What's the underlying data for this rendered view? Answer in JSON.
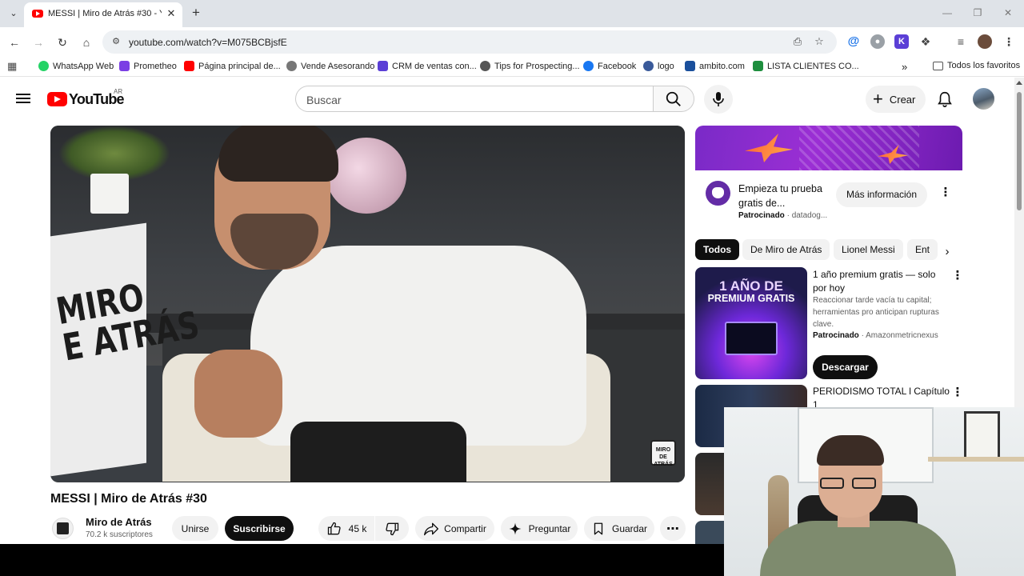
{
  "browser": {
    "tab_title": "MESSI | Miro de Atrás #30 - You",
    "url": "youtube.com/watch?v=M075BCBjsfE",
    "bookmarks": [
      {
        "label": "WhatsApp Web",
        "icon": "whatsapp-icon",
        "color": "#25d366"
      },
      {
        "label": "Prometheo",
        "icon": "prometheo-icon",
        "color": "#7b3fe4"
      },
      {
        "label": "Página principal de...",
        "icon": "youtube-icon",
        "color": "#ff0000"
      },
      {
        "label": "Vende Asesorando",
        "icon": "vende-icon",
        "color": "#555555"
      },
      {
        "label": "CRM de ventas con...",
        "icon": "crm-icon",
        "color": "#5b3fd6"
      },
      {
        "label": "Tips for Prospecting...",
        "icon": "gear-icon",
        "color": "#444444"
      },
      {
        "label": "Facebook",
        "icon": "facebook-icon",
        "color": "#1877f2"
      },
      {
        "label": "logo",
        "icon": "logo-icon",
        "color": "#3a5a9a"
      },
      {
        "label": "ambito.com",
        "icon": "ambito-icon",
        "color": "#1a4f9c"
      },
      {
        "label": "LISTA CLIENTES CO...",
        "icon": "sheets-icon",
        "color": "#1e8e3e"
      }
    ],
    "all_bookmarks_label": "Todos los favoritos"
  },
  "youtube": {
    "logo_text": "YouTube",
    "region": "AR",
    "search_placeholder": "Buscar",
    "create_label": "Crear",
    "video": {
      "title": "MESSI | Miro de Atrás #30",
      "channel_name": "Miro de Atrás",
      "subscribers": "70.2 k suscriptores",
      "join_label": "Unirse",
      "subscribe_label": "Suscribirse",
      "likes": "45 k",
      "share_label": "Compartir",
      "ask_label": "Preguntar",
      "save_label": "Guardar",
      "watermark_text": "MIRO DE ATRÁS",
      "cube_text": "MIRO\nE ATRÁS"
    },
    "ad_card": {
      "title": "Empieza tu prueba gratis de...",
      "sponsored_label": "Patrocinado",
      "advertiser": "datadog...",
      "cta_label": "Más información"
    },
    "chips": [
      "Todos",
      "De Miro de Atrás",
      "Lionel Messi",
      "Ent"
    ],
    "sidebar_ad": {
      "thumb_line1": "1 AÑO DE",
      "thumb_line2": "PREMIUM GRATIS",
      "title": "1 año premium gratis — solo por hoy",
      "description": "Reaccionar tarde vacía tu capital; herramientas pro anticipan rupturas clave.",
      "sponsored_label": "Patrocinado",
      "advertiser": "Amazonmetricnexus",
      "cta_label": "Descargar"
    },
    "recommendations": [
      {
        "title": "PERIODISMO TOTAL l Capítulo 1"
      }
    ]
  },
  "colors": {
    "youtube_red": "#ff0000",
    "chip_active": "#0f0f0f",
    "ad_purple": "#7a2ac7"
  }
}
